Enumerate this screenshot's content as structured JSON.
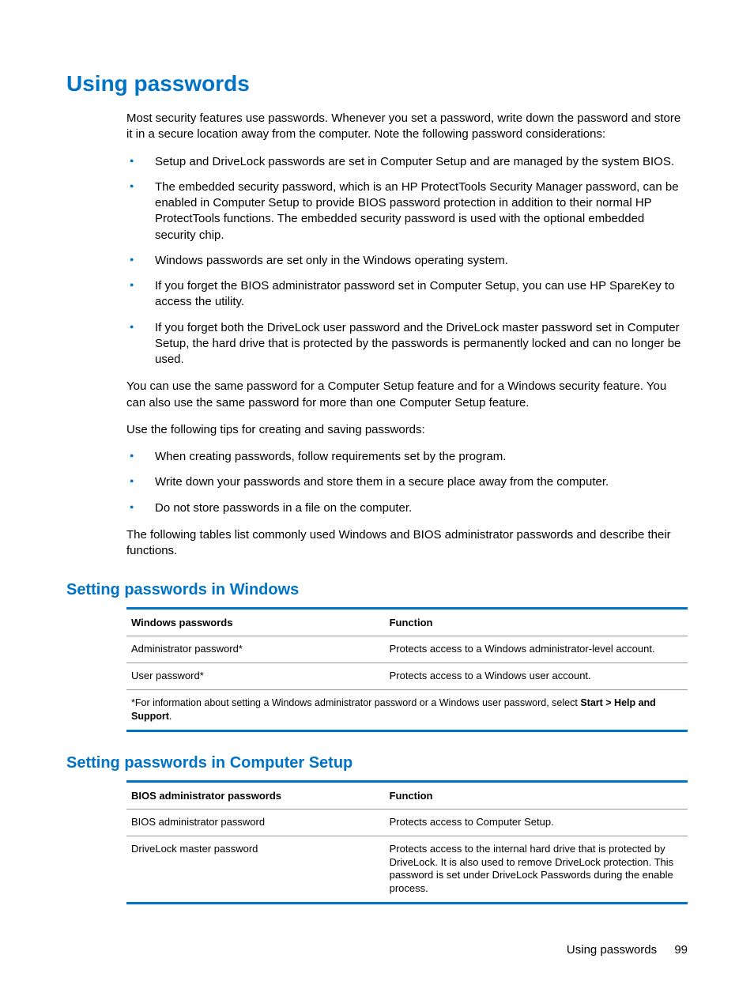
{
  "heading": "Using passwords",
  "intro": "Most security features use passwords. Whenever you set a password, write down the password and store it in a secure location away from the computer. Note the following password considerations:",
  "considerations": [
    "Setup and DriveLock passwords are set in Computer Setup and are managed by the system BIOS.",
    "The embedded security password, which is an HP ProtectTools Security Manager password, can be enabled in Computer Setup to provide BIOS password protection in addition to their normal HP ProtectTools functions. The embedded security password is used with the optional embedded security chip.",
    "Windows passwords are set only in the Windows operating system.",
    "If you forget the BIOS administrator password set in Computer Setup, you can use HP SpareKey to access the utility.",
    "If you forget both the DriveLock user password and the DriveLock master password set in Computer Setup, the hard drive that is protected by the passwords is permanently locked and can no longer be used."
  ],
  "para2": "You can use the same password for a Computer Setup feature and for a Windows security feature. You can also use the same password for more than one Computer Setup feature.",
  "para3": "Use the following tips for creating and saving passwords:",
  "tips": [
    "When creating passwords, follow requirements set by the program.",
    "Write down your passwords and store them in a secure place away from the computer.",
    "Do not store passwords in a file on the computer."
  ],
  "para4": "The following tables list commonly used Windows and BIOS administrator passwords and describe their functions.",
  "section1": {
    "title": "Setting passwords in Windows",
    "col1": "Windows passwords",
    "col2": "Function",
    "rows": [
      {
        "c1": "Administrator password*",
        "c2": "Protects access to a Windows administrator-level account."
      },
      {
        "c1": "User password*",
        "c2": "Protects access to a Windows user account."
      }
    ],
    "footnote_pre": "*For information about setting a Windows administrator password or a Windows user password, select ",
    "footnote_bold": "Start > Help and Support",
    "footnote_post": "."
  },
  "section2": {
    "title": "Setting passwords in Computer Setup",
    "col1": "BIOS administrator passwords",
    "col2": "Function",
    "rows": [
      {
        "c1": "BIOS administrator password",
        "c2": "Protects access to Computer Setup."
      },
      {
        "c1": "DriveLock master password",
        "c2": "Protects access to the internal hard drive that is protected by DriveLock. It is also used to remove DriveLock protection. This password is set under DriveLock Passwords during the enable process."
      }
    ]
  },
  "footer_text": "Using passwords",
  "page_number": "99"
}
